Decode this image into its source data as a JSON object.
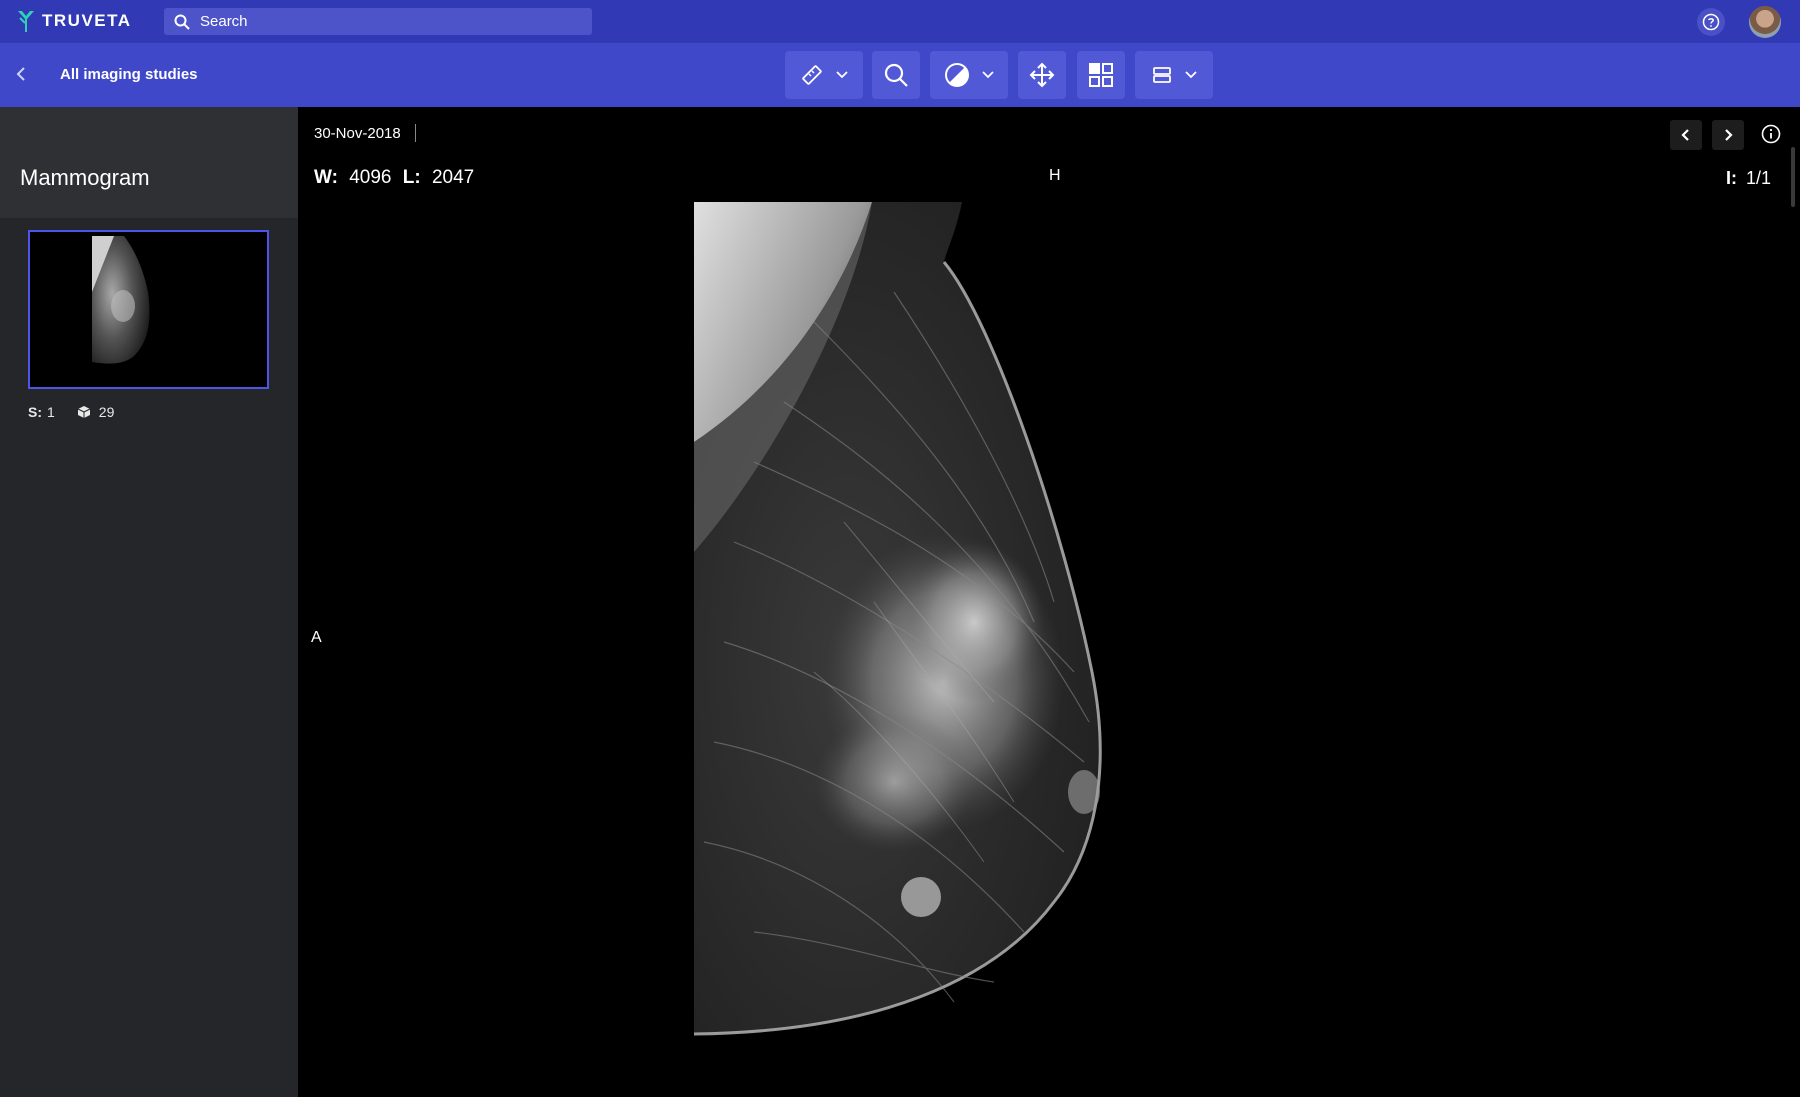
{
  "app": {
    "brand": "TRUVETA"
  },
  "search": {
    "placeholder": "Search",
    "value": ""
  },
  "header": {
    "help_icon": "help-circle-icon",
    "avatar_icon": "user-avatar"
  },
  "subbar": {
    "back_label": "All imaging studies"
  },
  "toolbar": {
    "tools": [
      {
        "name": "measure-tool",
        "icon": "ruler-icon",
        "dropdown": true
      },
      {
        "name": "zoom-tool",
        "icon": "search-icon",
        "dropdown": false
      },
      {
        "name": "contrast-tool",
        "icon": "contrast-icon",
        "dropdown": true
      },
      {
        "name": "pan-tool",
        "icon": "move-icon",
        "dropdown": false
      },
      {
        "name": "layout-tool",
        "icon": "grid-icon",
        "dropdown": false
      },
      {
        "name": "series-tool",
        "icon": "layers-icon",
        "dropdown": true
      }
    ]
  },
  "sidebar": {
    "study_title": "Mammogram",
    "series": [
      {
        "series_label": "S:",
        "series_value": "1",
        "instances": "29"
      }
    ]
  },
  "viewer": {
    "date": "30-Nov-2018",
    "window_label": "W:",
    "window_value": "4096",
    "level_label": "L:",
    "level_value": "2047",
    "orientation_top": "H",
    "orientation_left": "A",
    "image_label": "I:",
    "image_value": "1/1"
  },
  "colors": {
    "topbar": "#3239b4",
    "subbar": "#3f48c8",
    "tool_bg": "#5159d6",
    "sidebar": "#25262a",
    "selection": "#4b55e8",
    "brand_accent": "#2fd1b5"
  }
}
